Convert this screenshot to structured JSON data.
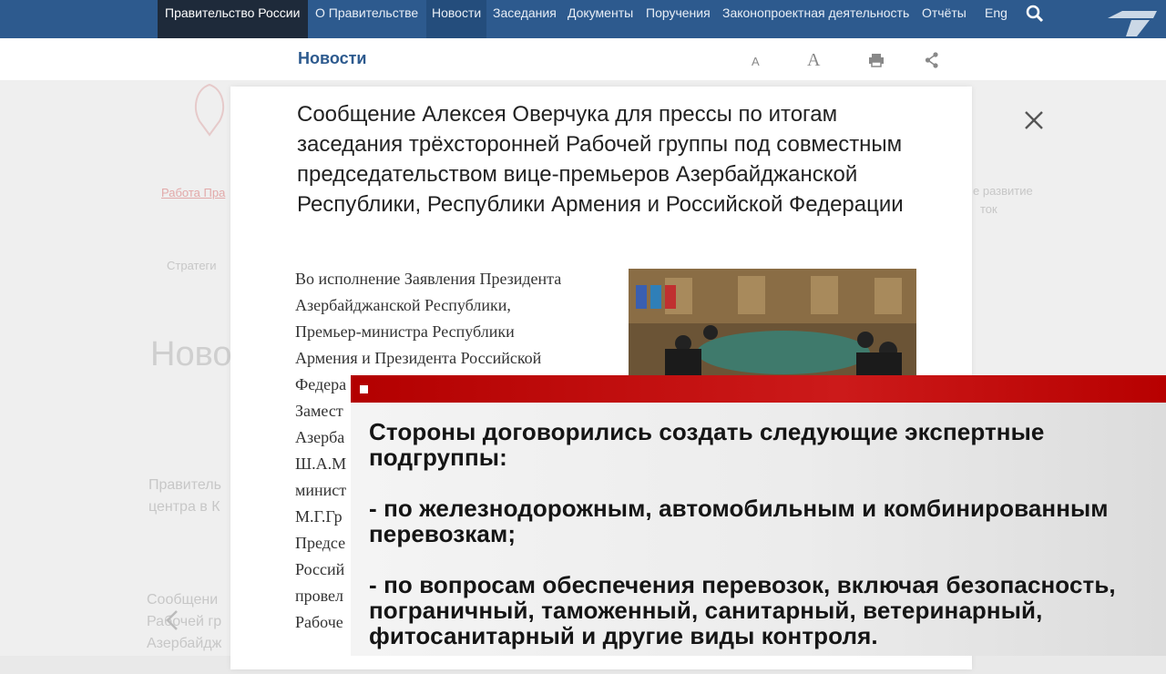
{
  "topnav": {
    "brand": "Правительство России",
    "items": [
      {
        "label": "О Правительстве"
      },
      {
        "label": "Новости",
        "active": true
      },
      {
        "label": "Заседания"
      },
      {
        "label": "Документы"
      },
      {
        "label": "Поручения"
      },
      {
        "label": "Законопроектная деятельность"
      },
      {
        "label": "Отчёты"
      },
      {
        "label": "Eng"
      }
    ]
  },
  "subheader": {
    "title": "Новости",
    "font_small": "A",
    "font_large": "A"
  },
  "background": {
    "link_red": "Работа Пра",
    "strategy": "Стратеги",
    "news_heading": "Ново",
    "snippet1": "Правитель",
    "snippet1b": "центра в К",
    "snippet2": "Сообщени",
    "snippet2b": "Рабочей гр",
    "snippet2c": "Азербайдж",
    "right1": "е развитие",
    "right2": "ток"
  },
  "modal": {
    "title": "Сообщение Алексея Оверчука для прессы по итогам заседания трёхсторонней Рабочей группы под совместным председательством вице-премьеров Азербайджанской Республики, Республики Армения и Российской Федерации",
    "body_lines": [
      "Во исполнение Заявления Президента",
      "Азербайджанской Республики,",
      "Премьер-министра Республики",
      "Армения и Президента Российской",
      "Федера",
      "Замест",
      "Азерба",
      "Ш.А.М",
      "минист",
      "М.Г.Гр",
      "Предсе",
      "Россий",
      "провел",
      "Рабоче"
    ]
  },
  "tv": {
    "paragraphs": [
      "Стороны договорились создать следующие экспертные подгруппы:",
      "- по железнодорожным, автомобильным и комбинированным перевозкам;",
      "- по вопросам обеспечения перевозок, включая безопасность, пограничный, таможенный, санитарный, ветеринарный, фитосанитарный и другие виды контроля."
    ],
    "bar_color": "#c00000"
  }
}
